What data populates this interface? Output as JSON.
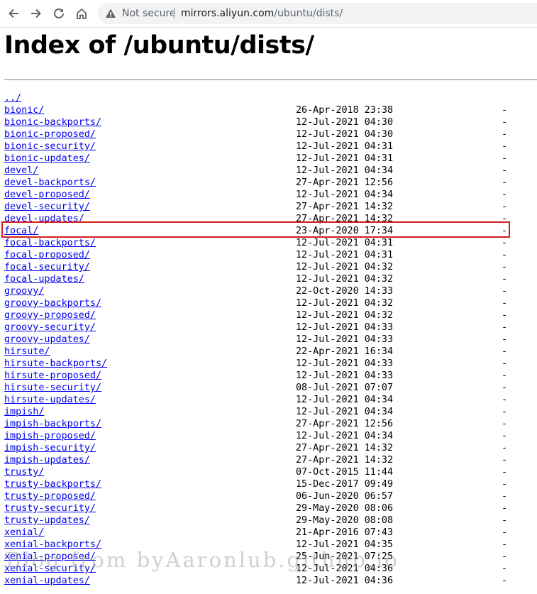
{
  "browser": {
    "security_label": "Not secure",
    "url_host": "mirrors.aliyun.com",
    "url_path": "/ubuntu/dists/"
  },
  "page": {
    "title": "Index of /ubuntu/dists/",
    "parent_link": "../"
  },
  "entries": [
    {
      "name": "bionic/",
      "date": "26-Apr-2018 23:38",
      "size": "-"
    },
    {
      "name": "bionic-backports/",
      "date": "12-Jul-2021 04:30",
      "size": "-"
    },
    {
      "name": "bionic-proposed/",
      "date": "12-Jul-2021 04:30",
      "size": "-"
    },
    {
      "name": "bionic-security/",
      "date": "12-Jul-2021 04:31",
      "size": "-"
    },
    {
      "name": "bionic-updates/",
      "date": "12-Jul-2021 04:31",
      "size": "-"
    },
    {
      "name": "devel/",
      "date": "12-Jul-2021 04:34",
      "size": "-"
    },
    {
      "name": "devel-backports/",
      "date": "27-Apr-2021 12:56",
      "size": "-"
    },
    {
      "name": "devel-proposed/",
      "date": "12-Jul-2021 04:34",
      "size": "-"
    },
    {
      "name": "devel-security/",
      "date": "27-Apr-2021 14:32",
      "size": "-"
    },
    {
      "name": "devel-updates/",
      "date": "27-Apr-2021 14:32",
      "size": "-"
    },
    {
      "name": "focal/",
      "date": "23-Apr-2020 17:34",
      "size": "-"
    },
    {
      "name": "focal-backports/",
      "date": "12-Jul-2021 04:31",
      "size": "-"
    },
    {
      "name": "focal-proposed/",
      "date": "12-Jul-2021 04:31",
      "size": "-"
    },
    {
      "name": "focal-security/",
      "date": "12-Jul-2021 04:32",
      "size": "-"
    },
    {
      "name": "focal-updates/",
      "date": "12-Jul-2021 04:32",
      "size": "-"
    },
    {
      "name": "groovy/",
      "date": "22-Oct-2020 14:33",
      "size": "-"
    },
    {
      "name": "groovy-backports/",
      "date": "12-Jul-2021 04:32",
      "size": "-"
    },
    {
      "name": "groovy-proposed/",
      "date": "12-Jul-2021 04:32",
      "size": "-"
    },
    {
      "name": "groovy-security/",
      "date": "12-Jul-2021 04:33",
      "size": "-"
    },
    {
      "name": "groovy-updates/",
      "date": "12-Jul-2021 04:33",
      "size": "-"
    },
    {
      "name": "hirsute/",
      "date": "22-Apr-2021 16:34",
      "size": "-"
    },
    {
      "name": "hirsute-backports/",
      "date": "12-Jul-2021 04:33",
      "size": "-"
    },
    {
      "name": "hirsute-proposed/",
      "date": "12-Jul-2021 04:33",
      "size": "-"
    },
    {
      "name": "hirsute-security/",
      "date": "08-Jul-2021 07:07",
      "size": "-"
    },
    {
      "name": "hirsute-updates/",
      "date": "12-Jul-2021 04:34",
      "size": "-"
    },
    {
      "name": "impish/",
      "date": "12-Jul-2021 04:34",
      "size": "-"
    },
    {
      "name": "impish-backports/",
      "date": "27-Apr-2021 12:56",
      "size": "-"
    },
    {
      "name": "impish-proposed/",
      "date": "12-Jul-2021 04:34",
      "size": "-"
    },
    {
      "name": "impish-security/",
      "date": "27-Apr-2021 14:32",
      "size": "-"
    },
    {
      "name": "impish-updates/",
      "date": "27-Apr-2021 14:32",
      "size": "-"
    },
    {
      "name": "trusty/",
      "date": "07-Oct-2015 11:44",
      "size": "-"
    },
    {
      "name": "trusty-backports/",
      "date": "15-Dec-2017 09:49",
      "size": "-"
    },
    {
      "name": "trusty-proposed/",
      "date": "06-Jun-2020 06:57",
      "size": "-"
    },
    {
      "name": "trusty-security/",
      "date": "29-May-2020 08:06",
      "size": "-"
    },
    {
      "name": "trusty-updates/",
      "date": "29-May-2020 08:08",
      "size": "-"
    },
    {
      "name": "xenial/",
      "date": "21-Apr-2016 07:43",
      "size": "-"
    },
    {
      "name": "xenial-backports/",
      "date": "12-Jul-2021 04:35",
      "size": "-"
    },
    {
      "name": "xenial-proposed/",
      "date": "25-Jun-2021 07:25",
      "size": "-"
    },
    {
      "name": "xenial-security/",
      "date": "12-Jul-2021 04:36",
      "size": "-"
    },
    {
      "name": "xenial-updates/",
      "date": "12-Jul-2021 04:36",
      "size": "-"
    }
  ],
  "highlight_entry": "focal/",
  "watermark": "Blog from byAaronlub.github.io",
  "colors": {
    "link": "#0000ee",
    "highlight_border": "#d42020"
  }
}
